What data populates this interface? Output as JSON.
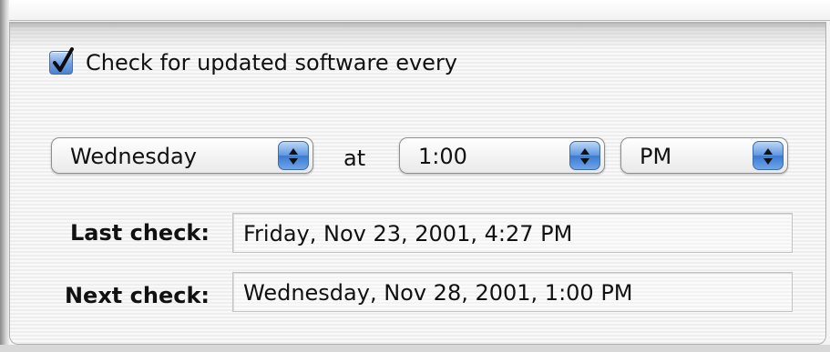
{
  "schedule": {
    "checkbox_label": "Check for updated software every",
    "checked": true,
    "day_popup": {
      "value": "Wednesday"
    },
    "at_label": "at",
    "time_popup": {
      "value": "1:00"
    },
    "ampm_popup": {
      "value": "PM"
    }
  },
  "status": {
    "last_check_label": "Last check:",
    "last_check_value": "Friday, Nov 23, 2001, 4:27 PM",
    "next_check_label": "Next check:",
    "next_check_value": "Wednesday, Nov 28, 2001, 1:00 PM"
  },
  "icons": {
    "checkmark": "checkmark-icon",
    "popup_arrows": "up-down-arrows-icon"
  },
  "colors": {
    "accent_blue": "#4b82d4",
    "pane_background": "#f4f4f4"
  }
}
